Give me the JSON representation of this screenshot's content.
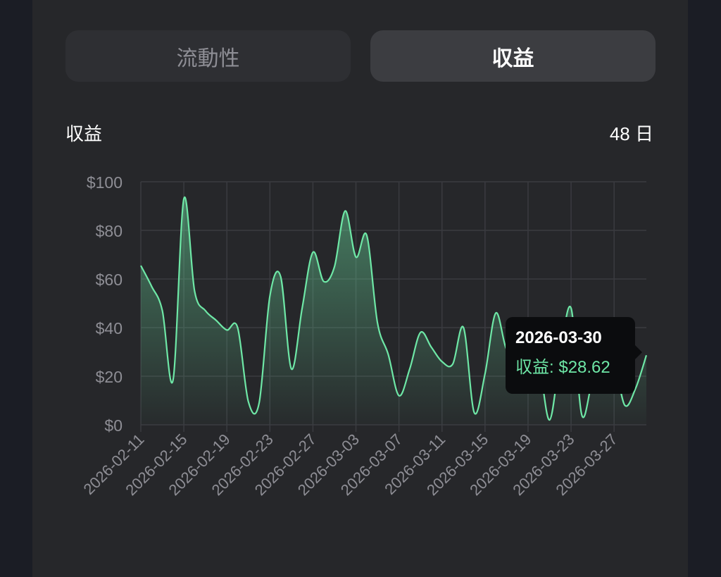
{
  "tabs": [
    {
      "label": "流動性",
      "active": false
    },
    {
      "label": "収益",
      "active": true
    }
  ],
  "header": {
    "title": "収益",
    "days": "48 日"
  },
  "colors": {
    "line": "#6ee7a6",
    "grid": "#3a3b40",
    "axis_text": "#8e8e95"
  },
  "tooltip": {
    "date": "2026-03-30",
    "series_label": "収益",
    "value_text": "$28.62"
  },
  "chart_data": {
    "type": "area",
    "ylim": [
      0,
      100
    ],
    "yticks": [
      0,
      20,
      40,
      60,
      80,
      100
    ],
    "ytick_labels": [
      "$0",
      "$20",
      "$40",
      "$60",
      "$80",
      "$100"
    ],
    "xtick_labels": [
      "2026-02-11",
      "2026-02-15",
      "2026-02-19",
      "2026-02-23",
      "2026-02-27",
      "2026-03-03",
      "2026-03-07",
      "2026-03-11",
      "2026-03-15",
      "2026-03-19",
      "2026-03-23",
      "2026-03-27"
    ],
    "grid": true,
    "series": [
      {
        "values": [
          {
            "x": "2026-02-11",
            "y": 65.5
          },
          {
            "x": "2026-02-12",
            "y": 57
          },
          {
            "x": "2026-02-13",
            "y": 47
          },
          {
            "x": "2026-02-14",
            "y": 18.5
          },
          {
            "x": "2026-02-15",
            "y": 93
          },
          {
            "x": "2026-02-16",
            "y": 55
          },
          {
            "x": "2026-02-17",
            "y": 47
          },
          {
            "x": "2026-02-18",
            "y": 43
          },
          {
            "x": "2026-02-19",
            "y": 39
          },
          {
            "x": "2026-02-20",
            "y": 40
          },
          {
            "x": "2026-02-21",
            "y": 9.5
          },
          {
            "x": "2026-02-22",
            "y": 9
          },
          {
            "x": "2026-02-23",
            "y": 53
          },
          {
            "x": "2026-02-24",
            "y": 61
          },
          {
            "x": "2026-02-25",
            "y": 23
          },
          {
            "x": "2026-02-26",
            "y": 48
          },
          {
            "x": "2026-02-27",
            "y": 71
          },
          {
            "x": "2026-02-28",
            "y": 59
          },
          {
            "x": "2026-03-01",
            "y": 65
          },
          {
            "x": "2026-03-02",
            "y": 88
          },
          {
            "x": "2026-03-03",
            "y": 69
          },
          {
            "x": "2026-03-04",
            "y": 78
          },
          {
            "x": "2026-03-05",
            "y": 42
          },
          {
            "x": "2026-03-06",
            "y": 29
          },
          {
            "x": "2026-03-07",
            "y": 12
          },
          {
            "x": "2026-03-08",
            "y": 23
          },
          {
            "x": "2026-03-09",
            "y": 38
          },
          {
            "x": "2026-03-10",
            "y": 32
          },
          {
            "x": "2026-03-11",
            "y": 26
          },
          {
            "x": "2026-03-12",
            "y": 25
          },
          {
            "x": "2026-03-13",
            "y": 40
          },
          {
            "x": "2026-03-14",
            "y": 5
          },
          {
            "x": "2026-03-15",
            "y": 21
          },
          {
            "x": "2026-03-16",
            "y": 46
          },
          {
            "x": "2026-03-17",
            "y": 31
          },
          {
            "x": "2026-03-18",
            "y": 31
          },
          {
            "x": "2026-03-19",
            "y": 33
          },
          {
            "x": "2026-03-20",
            "y": 26
          },
          {
            "x": "2026-03-21",
            "y": 2
          },
          {
            "x": "2026-03-22",
            "y": 29
          },
          {
            "x": "2026-03-23",
            "y": 48
          },
          {
            "x": "2026-03-24",
            "y": 4
          },
          {
            "x": "2026-03-25",
            "y": 18
          },
          {
            "x": "2026-03-26",
            "y": 20
          },
          {
            "x": "2026-03-27",
            "y": 25
          },
          {
            "x": "2026-03-28",
            "y": 8
          },
          {
            "x": "2026-03-29",
            "y": 15
          },
          {
            "x": "2026-03-30",
            "y": 28.62
          }
        ]
      }
    ]
  }
}
